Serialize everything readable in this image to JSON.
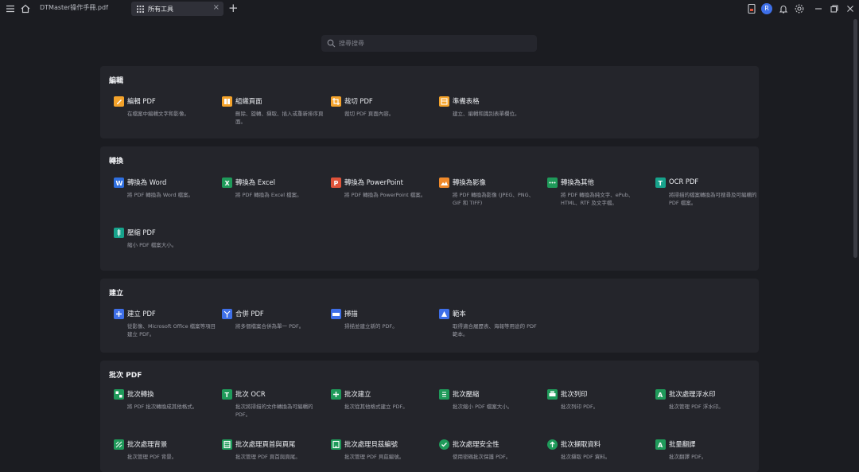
{
  "topbar": {
    "document_title": "DTMaster操作手冊.pdf",
    "active_tab_label": "所有工具",
    "avatar_letter": "R"
  },
  "search": {
    "placeholder": "搜尋搜尋"
  },
  "colors": {
    "background": "#1b1c21",
    "panel": "#24252b",
    "accent": "#3e6fe8"
  },
  "sections": [
    {
      "title": "編輯",
      "tools": [
        {
          "name": "編輯 PDF",
          "desc": "在檔案中編輯文字和影像。",
          "icon": "edit-pdf-icon",
          "color": "#f4a32b"
        },
        {
          "name": "組織頁面",
          "desc": "刪除、旋轉、擷取、插入或重新排序頁面。",
          "icon": "organize-pages-icon",
          "color": "#f4a32b"
        },
        {
          "name": "裁切 PDF",
          "desc": "裁切 PDF 頁面內容。",
          "icon": "crop-pdf-icon",
          "color": "#f4a32b"
        },
        {
          "name": "準備表格",
          "desc": "建立、編輯和識別表單欄位。",
          "icon": "prepare-form-icon",
          "color": "#f4a32b"
        }
      ]
    },
    {
      "title": "轉換",
      "tools": [
        {
          "name": "轉換為 Word",
          "desc": "將 PDF 轉換為 Word 檔案。",
          "icon": "word-icon",
          "color": "#2f6fe0"
        },
        {
          "name": "轉換為 Excel",
          "desc": "將 PDF 轉換為 Excel 檔案。",
          "icon": "excel-icon",
          "color": "#1f9a5a"
        },
        {
          "name": "轉換為 PowerPoint",
          "desc": "將 PDF 轉換為 PowerPoint 檔案。",
          "icon": "powerpoint-icon",
          "color": "#e0533a"
        },
        {
          "name": "轉換為影像",
          "desc": "將 PDF 轉換為影像 (JPEG、PNG、GIF 和 TIFF)",
          "icon": "image-icon",
          "color": "#f08a2b"
        },
        {
          "name": "轉換為其他",
          "desc": "將 PDF 轉換為純文字、ePub、HTML、RTF 及文字檔。",
          "icon": "convert-other-icon",
          "color": "#1f9a5a"
        },
        {
          "name": "OCR PDF",
          "desc": "將掃描的檔案轉換為可搜尋及可編輯的 PDF 檔案。",
          "icon": "ocr-icon",
          "color": "#17a38c"
        },
        {
          "name": "壓縮 PDF",
          "desc": "縮小 PDF 檔案大小。",
          "icon": "compress-icon",
          "color": "#17a38c"
        }
      ]
    },
    {
      "title": "建立",
      "tools": [
        {
          "name": "建立 PDF",
          "desc": "從影像、Microsoft Office 檔案等項目建立 PDF。",
          "icon": "create-pdf-icon",
          "color": "#3e6fe8"
        },
        {
          "name": "合併 PDF",
          "desc": "將多個檔案合併為單一 PDF。",
          "icon": "merge-pdf-icon",
          "color": "#3e6fe8"
        },
        {
          "name": "掃描",
          "desc": "掃描並建立新的 PDF。",
          "icon": "scan-icon",
          "color": "#3e6fe8"
        },
        {
          "name": "範本",
          "desc": "取得適合履歷表、海報等用途的 PDF 範本。",
          "icon": "template-icon",
          "color": "#3e6fe8"
        }
      ]
    },
    {
      "title": "批次 PDF",
      "tools": [
        {
          "name": "批次轉換",
          "desc": "將 PDF 批次轉換成其他格式。",
          "icon": "batch-convert-icon",
          "color": "#1f9a5a"
        },
        {
          "name": "批次 OCR",
          "desc": "批次將掃描的文件轉換為可編輯的 PDF。",
          "icon": "batch-ocr-icon",
          "color": "#1f9a5a"
        },
        {
          "name": "批次建立",
          "desc": "批次從其他格式建立 PDF。",
          "icon": "batch-create-icon",
          "color": "#1f9a5a"
        },
        {
          "name": "批次壓縮",
          "desc": "批次縮小 PDF 檔案大小。",
          "icon": "batch-compress-icon",
          "color": "#1f9a5a"
        },
        {
          "name": "批次列印",
          "desc": "批次列印 PDF。",
          "icon": "batch-print-icon",
          "color": "#1f9a5a"
        },
        {
          "name": "批次處理浮水印",
          "desc": "批次管理 PDF 浮水印。",
          "icon": "batch-watermark-icon",
          "color": "#1f9a5a"
        },
        {
          "name": "批次處理背景",
          "desc": "批次管理 PDF 背景。",
          "icon": "batch-background-icon",
          "color": "#1f9a5a"
        },
        {
          "name": "批次處理頁首與頁尾",
          "desc": "批次管理 PDF 頁首與頁尾。",
          "icon": "batch-header-footer-icon",
          "color": "#1f9a5a"
        },
        {
          "name": "批次處理貝茲編號",
          "desc": "批次管理 PDF 貝茲編號。",
          "icon": "batch-bates-icon",
          "color": "#1f9a5a"
        },
        {
          "name": "批次處理安全性",
          "desc": "使用密碼批次保護 PDF。",
          "icon": "batch-security-icon",
          "color": "#1f9a5a"
        },
        {
          "name": "批次擷取資料",
          "desc": "批次擷取 PDF 資料。",
          "icon": "batch-extract-icon",
          "color": "#1f9a5a"
        },
        {
          "name": "批量翻譯",
          "desc": "批次翻譯 PDF。",
          "icon": "batch-translate-icon",
          "color": "#1f9a5a"
        }
      ]
    }
  ]
}
